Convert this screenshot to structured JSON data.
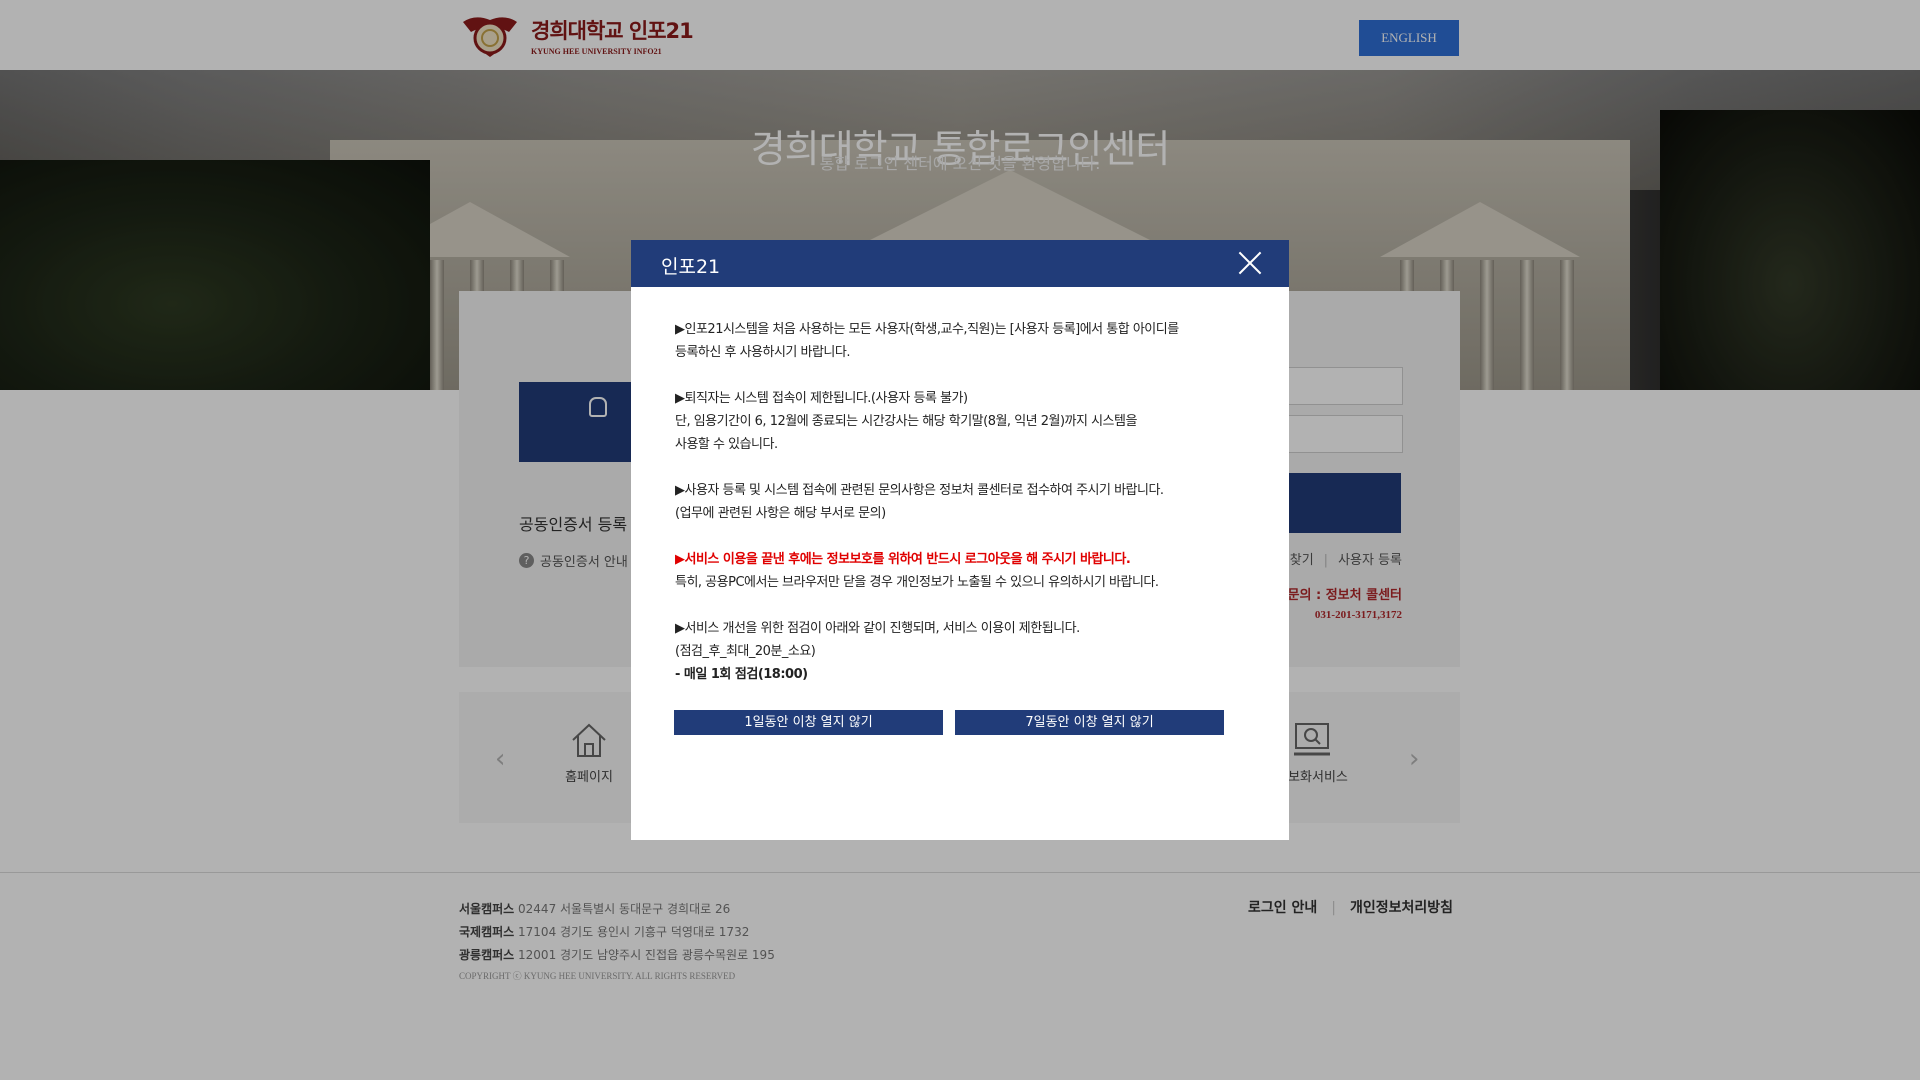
{
  "header": {
    "logo_ko": "경희대학교 인포21",
    "logo_en": "KYUNG HEE UNIVERSITY INFO21",
    "english_button": "ENGLISH"
  },
  "hero": {
    "title": "경희대학교 통합로그인센터",
    "subtitle": "통합 로그인 센터에 오신 것을 환영합니다."
  },
  "login": {
    "cert_heading": "공동인증서 등록 후",
    "cert_guide": "공동인증서 안내",
    "links": [
      "찾기",
      "사용자 등록"
    ],
    "contact": "경문의 : 정보처 콜센터",
    "contact_phone": "031-201-3171,3172"
  },
  "quick_menu": {
    "items": [
      {
        "label": "홈페이지",
        "icon": "house-icon"
      },
      {
        "label": "정보화서비스",
        "icon": "monitor-search-icon"
      }
    ]
  },
  "footer": {
    "campuses": [
      {
        "name": "서울캠퍼스",
        "address": "02447 서울특별시 동대문구 경희대로 26"
      },
      {
        "name": "국제캠퍼스",
        "address": "17104 경기도 용인시 기흥구 덕영대로 1732"
      },
      {
        "name": "광릉캠퍼스",
        "address": "12001 경기도 남양주시 진접읍 광릉수목원로 195"
      }
    ],
    "copyright": "COPYRIGHT ⓒ KYUNG HEE UNIVERSITY. ALL RIGHTS RESERVED",
    "links": [
      "로그인 안내",
      "개인정보처리방침"
    ]
  },
  "modal": {
    "title": "인포21",
    "paragraphs": [
      {
        "lines": [
          "▶인포21시스템을 처음 사용하는 모든 사용자(학생,교수,직원)는 [사용자 등록]에서 통합 아이디를",
          " 등록하신 후 사용하시기 바랍니다."
        ]
      },
      {
        "lines": [
          "▶퇴직자는 시스템 접속이 제한됩니다.(사용자 등록 불가)",
          " 단, 임용기간이 6, 12월에 종료되는 시간강사는 해당 학기말(8월, 익년 2월)까지 시스템을",
          "사용할 수 있습니다."
        ]
      },
      {
        "lines": [
          "▶사용자 등록 및 시스템 접속에 관련된 문의사항은 정보처 콜센터로 접수하여 주시기 바랍니다.",
          " (업무에 관련된 사항은 해당 부서로 문의)"
        ]
      },
      {
        "red": "▶서비스 이용을 끝낸 후에는 정보보호를 위하여 반드시 로그아웃을 해 주시기 바랍니다.",
        "lines": [
          " 특히, 공용PC에서는 브라우저만 닫을 경우 개인정보가 노출될 수 있으니 유의하시기 바랍니다."
        ]
      },
      {
        "lines": [
          "▶서비스 개선을 위한 점검이 아래와 같이 진행되며, 서비스 이용이 제한됩니다.",
          "(점검_후_최대_20분_소요)"
        ],
        "bold": " - 매일 1회 점검(18:00)"
      }
    ],
    "btn_1day": "1일동안 이창 열지 않기",
    "btn_7day": "7일동안 이창 열지 않기"
  }
}
